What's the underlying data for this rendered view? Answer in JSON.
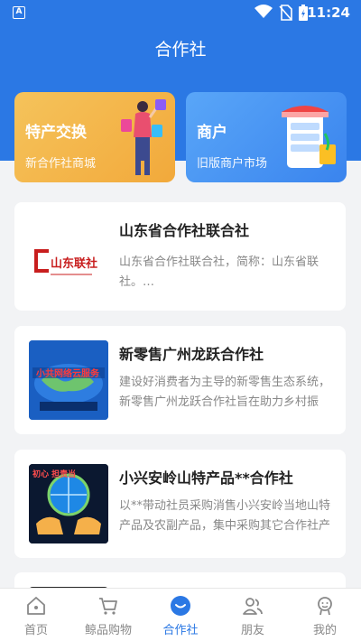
{
  "status_bar": {
    "time": "11:24"
  },
  "header": {
    "title": "合作社"
  },
  "promos": [
    {
      "title": "特产交换",
      "subtitle": "新合作社商城"
    },
    {
      "title": "商户",
      "subtitle": "旧版商户市场"
    }
  ],
  "cards": [
    {
      "title": "山东省合作社联合社",
      "desc": "山东省合作社联合社，简称：山东省联社。…",
      "logo_text": "山东联社"
    },
    {
      "title": "新零售广州龙跃合作社",
      "desc": "建设好消费者为主导的新零售生态系统，新零售广州龙跃合作社旨在助力乡村振兴…",
      "logo_text": "小共网络云服务"
    },
    {
      "title": "小兴安岭山特产品**合作社",
      "desc": "以**带动社员采购消售小兴安岭当地山特产品及农副产品，集中采购其它合作社产品…",
      "logo_text": "初心 担责当"
    }
  ],
  "tabbar": {
    "items": [
      {
        "label": "首页"
      },
      {
        "label": "鲸品购物"
      },
      {
        "label": "合作社"
      },
      {
        "label": "朋友"
      },
      {
        "label": "我的"
      }
    ],
    "active_color": "#2b78e4"
  }
}
